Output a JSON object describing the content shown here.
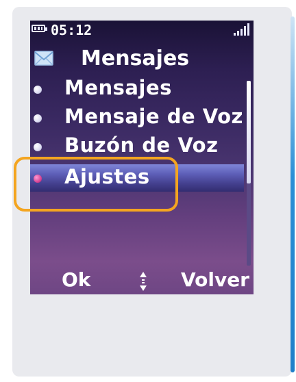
{
  "status_bar": {
    "time": "05:12",
    "battery_icon": "battery-icon",
    "signal_icon": "signal-strength-icon"
  },
  "header": {
    "icon": "envelope-icon",
    "title": "Mensajes"
  },
  "menu": {
    "items": [
      {
        "label": "Mensajes",
        "selected": false
      },
      {
        "label": "Mensaje de Voz",
        "selected": false
      },
      {
        "label": "Buzón de Voz",
        "selected": false
      },
      {
        "label": "Ajustes",
        "selected": true
      }
    ]
  },
  "softkeys": {
    "left": "Ok",
    "center_icon": "up-down-arrows-icon",
    "right": "Volver"
  },
  "annotation": {
    "highlight_color": "#f4a520",
    "highlighted_item": "Ajustes"
  }
}
